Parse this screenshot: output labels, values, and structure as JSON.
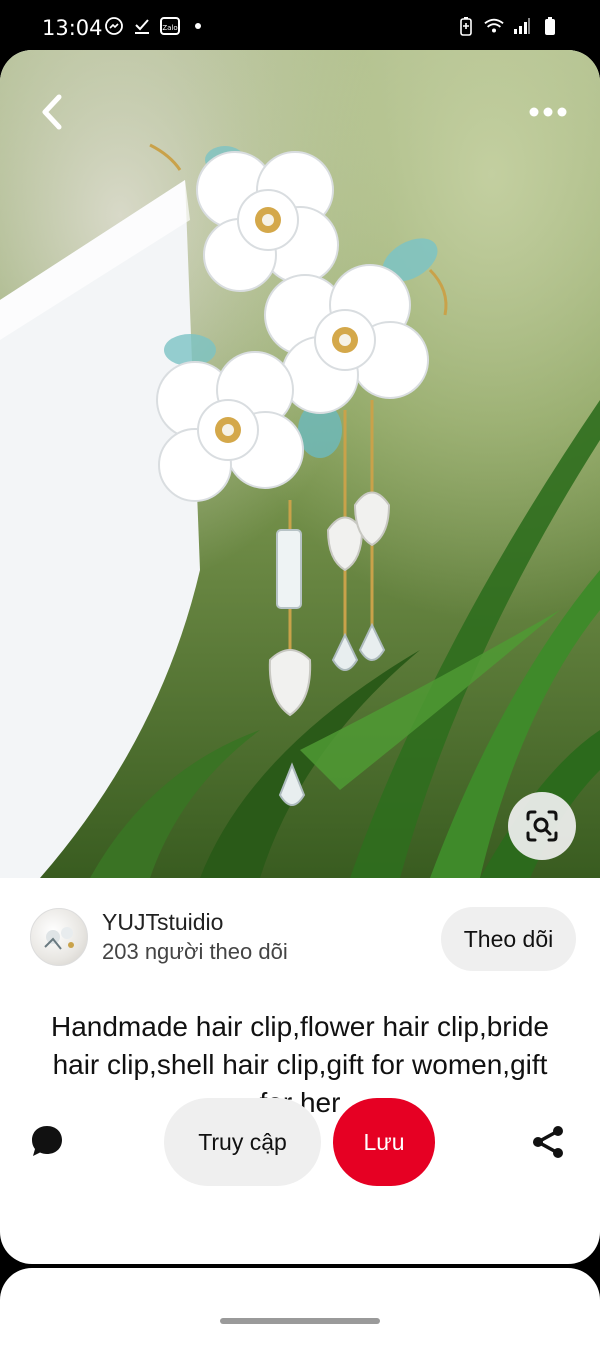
{
  "status_bar": {
    "time": "13:04",
    "left_icons": [
      "messenger-icon",
      "download-check-icon",
      "zalo-icon",
      "dot-icon"
    ],
    "zalo_label": "Zalo",
    "right_icons": [
      "battery-saver-icon",
      "wifi-icon",
      "signal-icon",
      "battery-icon"
    ]
  },
  "pin": {
    "title": "Handmade hair clip,flower hair clip,bride hair clip,shell hair clip,gift for women,gift for her",
    "author": {
      "name": "YUJTstuidio",
      "followers": "203 người theo dõi"
    },
    "follow_label": "Theo dõi"
  },
  "actions": {
    "visit_label": "Truy cập",
    "save_label": "Lưu"
  },
  "colors": {
    "save_red": "#e60023",
    "button_gray": "#efefef"
  }
}
